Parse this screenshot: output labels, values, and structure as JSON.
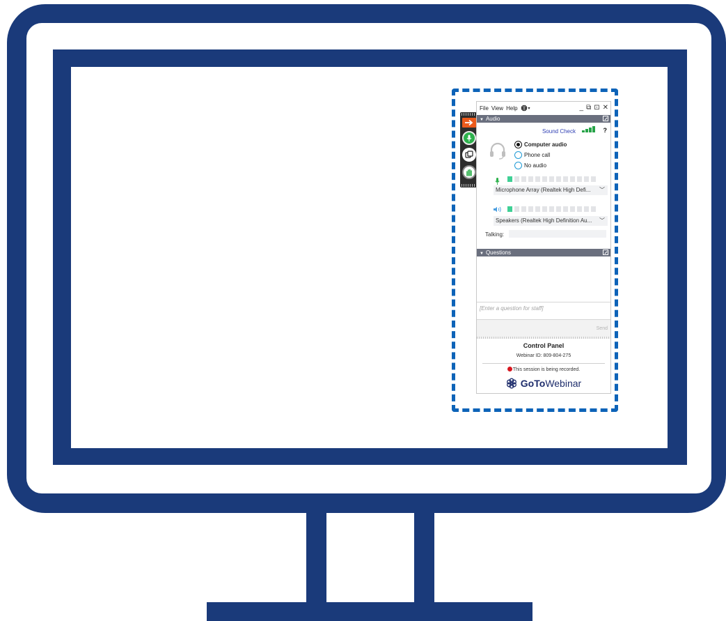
{
  "menu": {
    "items": [
      "File",
      "View",
      "Help"
    ]
  },
  "window_controls": {
    "minimize": "_",
    "restore": "⧉",
    "popout": "⊡",
    "close": "✕"
  },
  "audio": {
    "header": "Audio",
    "sound_check": "Sound Check",
    "help": "?",
    "options": [
      "Computer audio",
      "Phone call",
      "No audio"
    ],
    "selected": "Computer audio",
    "microphone": "Microphone Array (Realtek High Defi...",
    "speakers": "Speakers (Realtek High Definition Au...",
    "talking_label": "Talking:"
  },
  "questions": {
    "header": "Questions",
    "placeholder": "[Enter a question for staff]",
    "send": "Send"
  },
  "footer": {
    "title": "Control Panel",
    "webinar_id": "Webinar ID: 809-804-275",
    "recording": "This session is being recorded.",
    "logo_bold": "GoTo",
    "logo_light": "Webinar"
  },
  "colors": {
    "monitor": "#1a3a7a",
    "highlight": "#0d63b8",
    "section_header": "#6a6f7e",
    "accent_orange": "#ec5b1d",
    "accent_green": "#2db14c",
    "link_blue": "#2f3fb3",
    "meter_on": "#3fd095",
    "recording_red": "#d7171f"
  },
  "icons": [
    "grab-arrow-icon",
    "microphone-icon",
    "screen-share-icon",
    "raise-hand-icon",
    "globe-icon",
    "headset-icon",
    "speaker-icon",
    "popout-icon",
    "chevron-down-icon",
    "gotowebinar-logo-icon"
  ]
}
